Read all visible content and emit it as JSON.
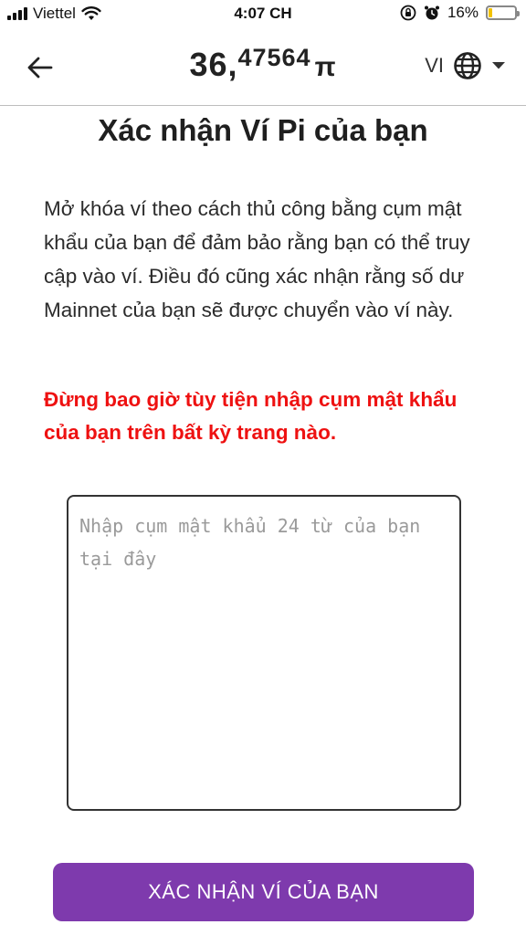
{
  "status_bar": {
    "carrier": "Viettel",
    "time": "4:07 CH",
    "battery_percent": "16%",
    "battery_level": 0.16,
    "battery_color": "#f2c200"
  },
  "header": {
    "back_icon": "arrow-left-icon",
    "balance_integer": "36,",
    "balance_decimals": "47564",
    "currency_symbol": "π",
    "language": "VI",
    "globe_icon": "globe-icon",
    "dropdown_icon": "caret-down-icon"
  },
  "main": {
    "title": "Xác nhận Ví Pi của bạn",
    "description": "Mở khóa ví theo cách thủ công bằng cụm mật khẩu của bạn để đảm bảo rằng bạn có thể truy cập vào ví. Điều đó cũng xác nhận rằng số dư Mainnet của bạn sẽ được chuyển vào ví này.",
    "warning": "Đừng bao giờ tùy tiện nhập cụm mật khẩu của bạn trên bất kỳ trang nào.",
    "warning_color": "#ee1111",
    "passphrase": {
      "value": "",
      "placeholder": "Nhập cụm mật khẩu 24 từ của bạn tại đây"
    },
    "confirm_button_label": "XÁC NHẬN VÍ CỦA BẠN",
    "accent_color": "#7e3aad"
  }
}
